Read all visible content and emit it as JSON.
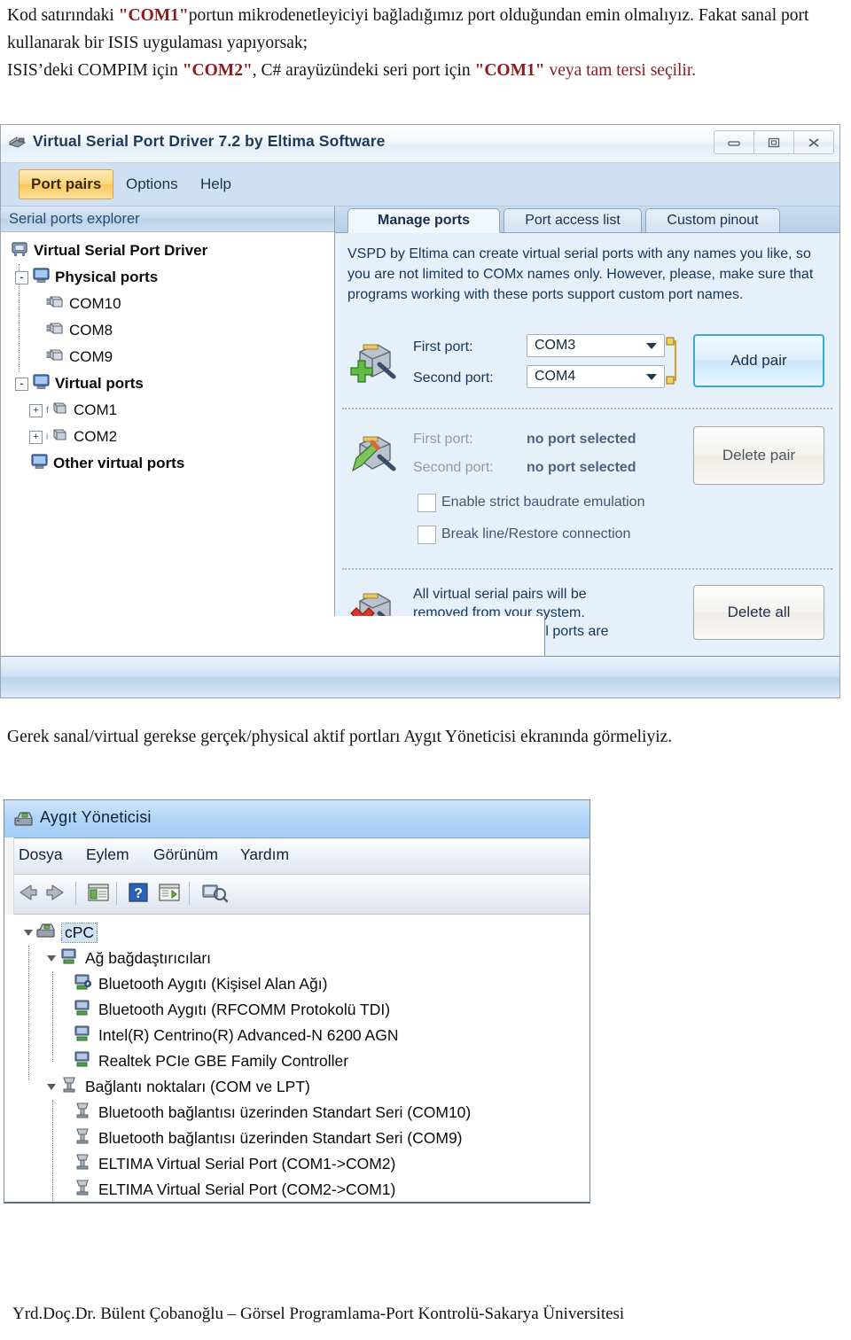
{
  "intro": {
    "line1_a": "Kod satırındaki  ",
    "line1_com": "\"COM1\"",
    "line1_b": "portun mikrodenetleyiciyi bağladığımız port olduğundan emin olmalıyız. ",
    "line2_a": "Fakat sanal port kullanarak bir ISIS uygulaması yapıyorsak;",
    "line3_a": "ISIS’deki COMPIM için  ",
    "line3_com1": "\"COM2\"",
    "line3_b": ", C# arayüzündeki seri port için ",
    "line3_com2": "\"COM1\"",
    "line3_c": " veya tam tersi seçilir."
  },
  "midtext": "Gerek sanal/virtual gerekse gerçek/physical aktif portları Aygıt Yöneticisi ekranında görmeliyiz.",
  "footer": "Yrd.Doç.Dr. Bülent Çobanoğlu – Görsel Programlama-Port Kontrolü-Sakarya Üniversitesi",
  "colors": {
    "accent_red": "#8d1b1b",
    "vspd_panel": "#e6f0fa",
    "vspd_menubar": "#cfe0f2",
    "active_menu_amber": "#f8c85c",
    "primary_button_border": "#3aa6e0",
    "devmgr_title": "#aed4f7"
  },
  "vspd": {
    "window_title": "Virtual Serial Port Driver 7.2 by Eltima Software",
    "title_icon": "serial-port-icon",
    "window_buttons": [
      {
        "name": "minimize-button",
        "glyph": "minimize"
      },
      {
        "name": "maximize-button",
        "glyph": "maximize"
      },
      {
        "name": "close-button",
        "glyph": "close"
      }
    ],
    "menu": [
      {
        "label": "Port pairs",
        "accel": "P",
        "active": true
      },
      {
        "label": "Options",
        "accel": "O",
        "active": false
      },
      {
        "label": "Help",
        "accel": "H",
        "active": false
      }
    ],
    "explorer": {
      "header": "Serial ports explorer",
      "tree": [
        {
          "label": "Virtual Serial Port Driver",
          "depth": 0,
          "bold": true,
          "expander": "",
          "icon": "driver-icon"
        },
        {
          "label": "Physical ports",
          "depth": 1,
          "bold": true,
          "expander": "-",
          "icon": "computer-icon"
        },
        {
          "label": "COM10",
          "depth": 2,
          "bold": false,
          "expander": "",
          "icon": "port-icon"
        },
        {
          "label": "COM8",
          "depth": 2,
          "bold": false,
          "expander": "",
          "icon": "port-icon"
        },
        {
          "label": "COM9",
          "depth": 2,
          "bold": false,
          "expander": "",
          "icon": "port-icon"
        },
        {
          "label": "Virtual ports",
          "depth": 1,
          "bold": true,
          "expander": "-",
          "icon": "computer-icon"
        },
        {
          "label": "COM1",
          "depth": 2,
          "bold": false,
          "expander": "+",
          "icon": "virtual-port-icon"
        },
        {
          "label": "COM2",
          "depth": 2,
          "bold": false,
          "expander": "+",
          "icon": "virtual-port-icon"
        },
        {
          "label": "Other virtual ports",
          "depth": 1,
          "bold": true,
          "expander": "",
          "icon": "computer-icon"
        }
      ]
    },
    "tabs": [
      {
        "label": "Manage ports",
        "selected": true
      },
      {
        "label": "Port access list",
        "selected": false
      },
      {
        "label": "Custom pinout",
        "selected": false
      }
    ],
    "blurb": "VSPD by Eltima can create virtual serial ports with any names you like, so you are not limited to COMx names only. However, please, make sure that programs working with these ports support custom port names.",
    "add_pair": {
      "icon": "add-port-pair-icon",
      "first_port_label": "First port:",
      "first_port_value": "COM3",
      "second_port_label": "Second port:",
      "second_port_value": "COM4",
      "button_label": "Add pair"
    },
    "delete_pair": {
      "icon": "edit-port-pair-icon",
      "first_port_label": "First port:",
      "first_port_value": "no port selected",
      "second_port_label": "Second port:",
      "second_port_value": "no port selected",
      "button_label": "Delete pair",
      "checkbox_baudrate": "Enable strict baudrate emulation",
      "checkbox_breakline": "Break line/Restore connection",
      "baudrate_checked": false,
      "breakline_checked": false
    },
    "delete_all": {
      "icon": "delete-port-pair-icon",
      "text": "All virtual serial pairs will be removed from your system. Please, make sure all ports are closed.",
      "button_label": "Delete all"
    }
  },
  "devmgr": {
    "window_title": "Aygıt Yöneticisi",
    "title_icon": "device-manager-icon",
    "menu": [
      "Dosya",
      "Eylem",
      "Görünüm",
      "Yardım"
    ],
    "toolbar": [
      {
        "name": "back-icon"
      },
      {
        "name": "forward-icon"
      },
      {
        "name": "properties-icon"
      },
      {
        "name": "help-icon"
      },
      {
        "name": "scan-icon"
      },
      {
        "name": "update-driver-icon"
      }
    ],
    "tree": [
      {
        "label": "cPC",
        "depth": 0,
        "twisty": "open",
        "icon": "computer-icon",
        "selected": true
      },
      {
        "label": "Ağ bağdaştırıcıları",
        "depth": 1,
        "twisty": "open",
        "icon": "network-icon",
        "selected": false
      },
      {
        "label": "Bluetooth Aygıtı (Kişisel Alan Ağı)",
        "depth": 2,
        "twisty": "",
        "icon": "network-device-icon",
        "selected": false
      },
      {
        "label": "Bluetooth Aygıtı (RFCOMM Protokolü TDI)",
        "depth": 2,
        "twisty": "",
        "icon": "network-device-icon",
        "selected": false
      },
      {
        "label": "Intel(R) Centrino(R) Advanced-N 6200 AGN",
        "depth": 2,
        "twisty": "",
        "icon": "network-device-icon",
        "selected": false
      },
      {
        "label": "Realtek PCIe GBE Family Controller",
        "depth": 2,
        "twisty": "",
        "icon": "network-device-icon",
        "selected": false
      },
      {
        "label": "Bağlantı noktaları (COM ve LPT)",
        "depth": 1,
        "twisty": "open",
        "icon": "port-device-icon",
        "selected": false
      },
      {
        "label": "Bluetooth bağlantısı üzerinden Standart Seri (COM10)",
        "depth": 2,
        "twisty": "",
        "icon": "port-device-icon",
        "selected": false
      },
      {
        "label": "Bluetooth bağlantısı üzerinden Standart Seri (COM9)",
        "depth": 2,
        "twisty": "",
        "icon": "port-device-icon",
        "selected": false
      },
      {
        "label": "ELTIMA Virtual Serial Port (COM1->COM2)",
        "depth": 2,
        "twisty": "",
        "icon": "port-device-icon",
        "selected": false
      },
      {
        "label": "ELTIMA Virtual Serial Port (COM2->COM1)",
        "depth": 2,
        "twisty": "",
        "icon": "port-device-icon",
        "selected": false
      }
    ]
  }
}
